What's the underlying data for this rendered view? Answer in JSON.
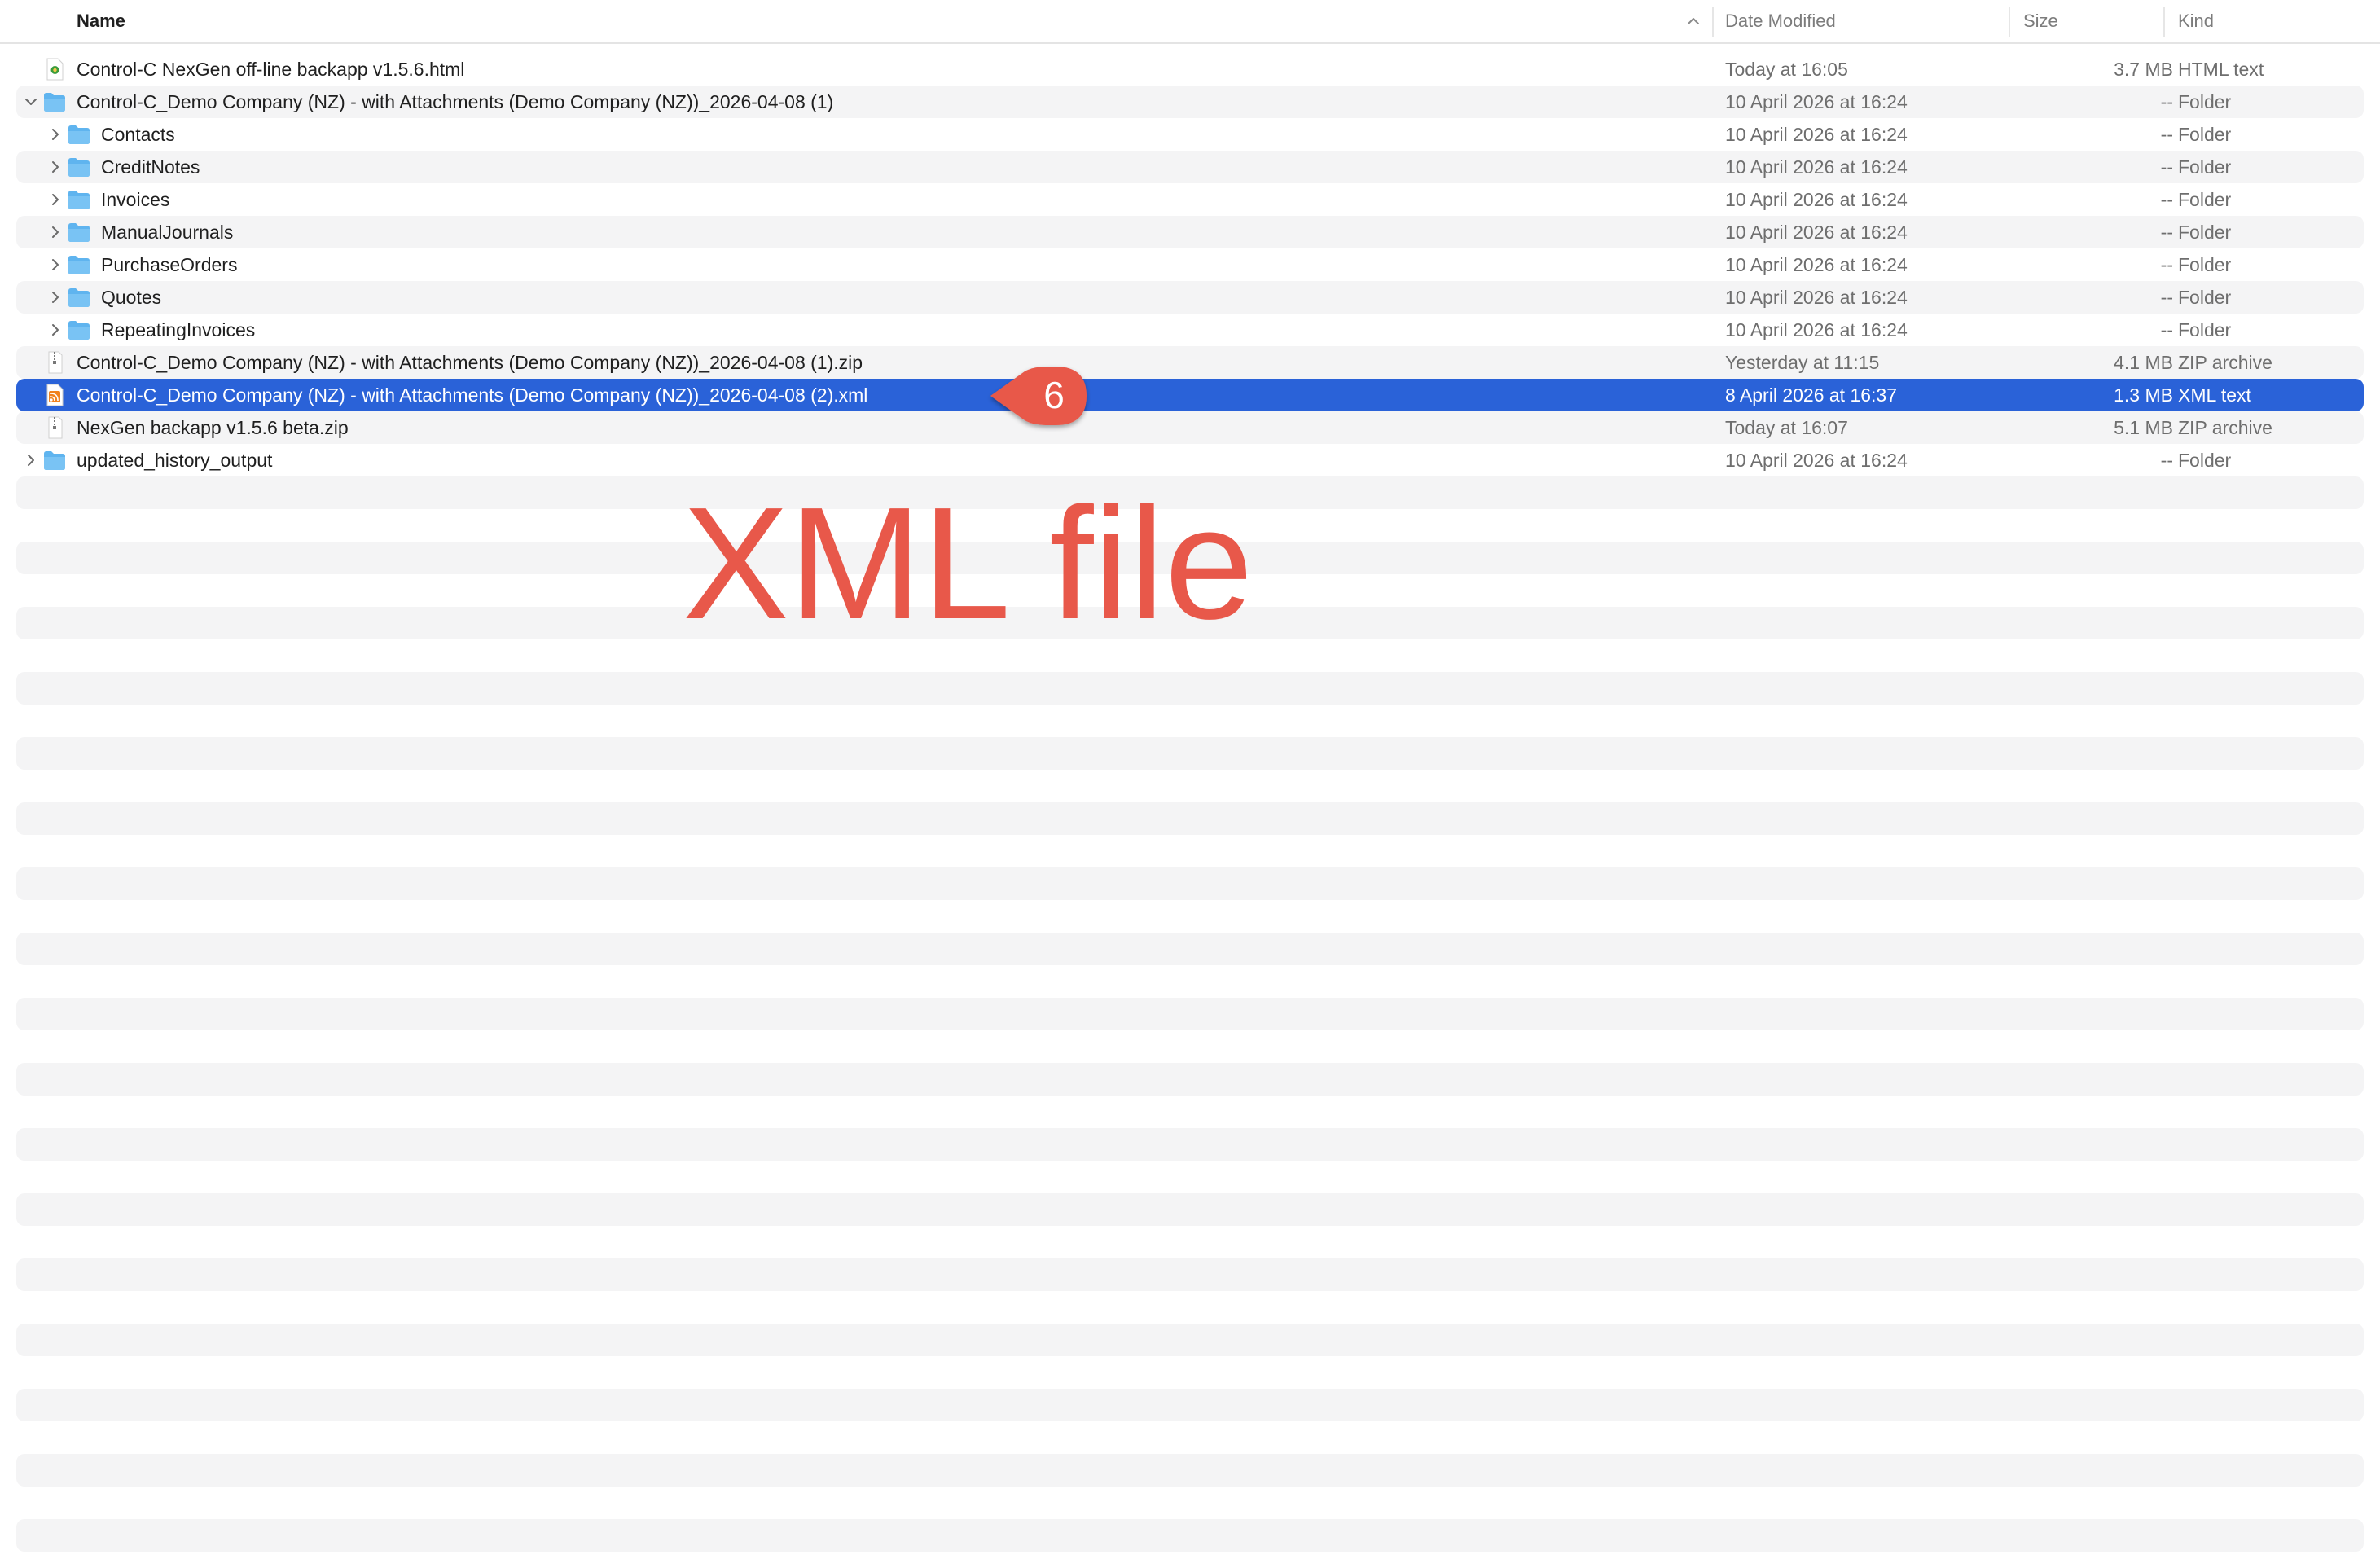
{
  "header": {
    "name": "Name",
    "date_modified": "Date Modified",
    "size": "Size",
    "kind": "Kind"
  },
  "files": [
    {
      "name": "Control-C NexGen off-line backapp v1.5.6.html",
      "date": "Today at 16:05",
      "size": "3.7 MB",
      "kind": "HTML text",
      "icon": "html-file-icon",
      "indent": 0,
      "disclosure": "none"
    },
    {
      "name": "Control-C_Demo Company (NZ) - with Attachments (Demo Company (NZ))_2026-04-08 (1)",
      "date": "10 April 2026 at 16:24",
      "size": "--",
      "kind": "Folder",
      "icon": "folder-icon",
      "indent": 0,
      "disclosure": "expanded"
    },
    {
      "name": "Contacts",
      "date": "10 April 2026 at 16:24",
      "size": "--",
      "kind": "Folder",
      "icon": "folder-icon",
      "indent": 1,
      "disclosure": "collapsed"
    },
    {
      "name": "CreditNotes",
      "date": "10 April 2026 at 16:24",
      "size": "--",
      "kind": "Folder",
      "icon": "folder-icon",
      "indent": 1,
      "disclosure": "collapsed"
    },
    {
      "name": "Invoices",
      "date": "10 April 2026 at 16:24",
      "size": "--",
      "kind": "Folder",
      "icon": "folder-icon",
      "indent": 1,
      "disclosure": "collapsed"
    },
    {
      "name": "ManualJournals",
      "date": "10 April 2026 at 16:24",
      "size": "--",
      "kind": "Folder",
      "icon": "folder-icon",
      "indent": 1,
      "disclosure": "collapsed"
    },
    {
      "name": "PurchaseOrders",
      "date": "10 April 2026 at 16:24",
      "size": "--",
      "kind": "Folder",
      "icon": "folder-icon",
      "indent": 1,
      "disclosure": "collapsed"
    },
    {
      "name": "Quotes",
      "date": "10 April 2026 at 16:24",
      "size": "--",
      "kind": "Folder",
      "icon": "folder-icon",
      "indent": 1,
      "disclosure": "collapsed"
    },
    {
      "name": "RepeatingInvoices",
      "date": "10 April 2026 at 16:24",
      "size": "--",
      "kind": "Folder",
      "icon": "folder-icon",
      "indent": 1,
      "disclosure": "collapsed"
    },
    {
      "name": "Control-C_Demo Company (NZ) - with Attachments (Demo Company (NZ))_2026-04-08 (1).zip",
      "date": "Yesterday at 11:15",
      "size": "4.1 MB",
      "kind": "ZIP archive",
      "icon": "zip-file-icon",
      "indent": 0,
      "disclosure": "none"
    },
    {
      "name": "Control-C_Demo Company (NZ) - with Attachments (Demo Company (NZ))_2026-04-08 (2).xml",
      "date": "8 April 2026 at 16:37",
      "size": "1.3 MB",
      "kind": "XML text",
      "icon": "xml-file-icon",
      "indent": 0,
      "disclosure": "none",
      "selected": true
    },
    {
      "name": "NexGen backapp v1.5.6 beta.zip",
      "date": "Today at 16:07",
      "size": "5.1 MB",
      "kind": "ZIP archive",
      "icon": "zip-file-icon",
      "indent": 0,
      "disclosure": "none"
    },
    {
      "name": "updated_history_output",
      "date": "10 April 2026 at 16:24",
      "size": "--",
      "kind": "Folder",
      "icon": "folder-icon",
      "indent": 0,
      "disclosure": "collapsed"
    }
  ],
  "annotation": {
    "step_number": "6",
    "label": "XML file",
    "color": "#e8584a"
  },
  "colors": {
    "selection": "#2a62d8",
    "stripe": "#f4f4f5",
    "folder": "#5fb4ef"
  }
}
